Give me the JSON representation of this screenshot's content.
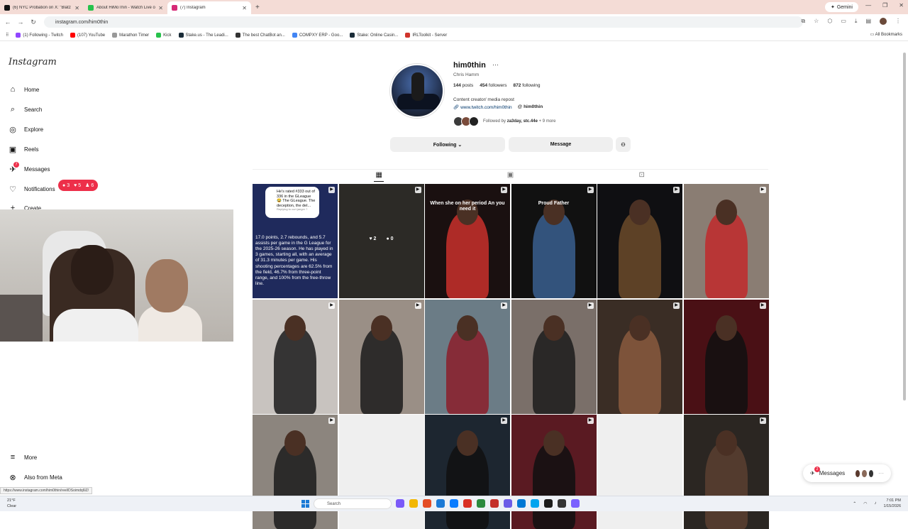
{
  "browser": {
    "tabs": [
      {
        "title": "(6) NYC Probation on X: \"Blatz",
        "color": "#111111"
      },
      {
        "title": "About HiMoThin - Watch Live o",
        "color": "#27c24c"
      },
      {
        "title": "(7) Instagram",
        "color": "#d62976"
      }
    ],
    "gemini_label": "Gemini",
    "url": "instagram.com/him0thin",
    "bookmarks": [
      {
        "label": "(1) Following - Twitch",
        "color": "#9146ff"
      },
      {
        "label": "(107) YouTube",
        "color": "#ff0000"
      },
      {
        "label": "Marathon Timer",
        "color": "#999999"
      },
      {
        "label": "Kick",
        "color": "#27c24c"
      },
      {
        "label": "Stake.us - The Leadi...",
        "color": "#1a2c38"
      },
      {
        "label": "The best ChatBot an...",
        "color": "#333333"
      },
      {
        "label": "COMPXY ERP - Goo...",
        "color": "#4285f4"
      },
      {
        "label": "Stake: Online Casin...",
        "color": "#1a2c38"
      },
      {
        "label": "IRLToolkit - Server",
        "color": "#d0342c"
      }
    ],
    "all_bookmarks": "All Bookmarks",
    "status_url": "https://www.instagram.com/him0thin/reel/DSoimdq6lZ/"
  },
  "sidebar": {
    "logo": "Instagram",
    "items": [
      {
        "label": "Home",
        "icon": "home-icon",
        "glyph": "⌂"
      },
      {
        "label": "Search",
        "icon": "search-icon",
        "glyph": "⌕"
      },
      {
        "label": "Explore",
        "icon": "explore-icon",
        "glyph": "◎"
      },
      {
        "label": "Reels",
        "icon": "reels-icon",
        "glyph": "▣"
      },
      {
        "label": "Messages",
        "icon": "messages-icon",
        "glyph": "✈"
      },
      {
        "label": "Notifications",
        "icon": "heart-icon",
        "glyph": "♡"
      },
      {
        "label": "Create",
        "icon": "plus-icon",
        "glyph": "+"
      }
    ],
    "messages_badge": "7",
    "notif_counts": {
      "comments": "3",
      "likes": "5",
      "follows": "6"
    },
    "more": "More",
    "also_from_meta": "Also from Meta"
  },
  "profile": {
    "username": "him0thin",
    "full_name": "Chris Hamm",
    "posts": "144",
    "posts_label": "posts",
    "followers": "454",
    "followers_label": "followers",
    "following": "872",
    "following_label": "following",
    "bio": "Content creator/ media repost",
    "link": "www.twitch.com/him0thin",
    "threads": "him0thin",
    "followed_by_prefix": "Followed by ",
    "followed_by_names": "za3day, stc.44e",
    "followed_by_more": " + 9 more",
    "following_button": "Following ⌄",
    "message_button": "Message",
    "suggest_icon": "add-person-icon"
  },
  "grid": {
    "posts": [
      {
        "bg": "#1f2a5c",
        "bubble": "He's rated #333 out of 336 in the GLeague 😂 The GLeague. The deception, the del...",
        "bubble_reply": "Replying to curt.jaeger ?",
        "caption": "17.0 points, 2.7 rebounds, and 5.7 assists per game in the G League for the 2025-26 season. He has played in 3 games, starting all, with an average of 31.3 minutes per game. His shooting percentages are 62.5% from the field, 46.7% from three-point range, and 100% from the free-throw line."
      },
      {
        "bg": "#2c2a26",
        "likes": "2",
        "comments": "0"
      },
      {
        "bg": "#1a1010",
        "overlay": "When she on her period An you need it",
        "accent": "#c9302c"
      },
      {
        "bg": "#111111",
        "overlay": "Proud Father",
        "accent": "#3a5f8f"
      },
      {
        "bg": "#0f0f12",
        "accent": "#6b4a2a"
      },
      {
        "bg": "#8a7d73",
        "accent": "#c0292b"
      },
      {
        "bg": "#c8c3bf",
        "accent": "#1b1b1b"
      },
      {
        "bg": "#9a8f86",
        "accent": "#1b1b1b"
      },
      {
        "bg": "#6b7c86",
        "accent": "#8b1e2a"
      },
      {
        "bg": "#7a6f69",
        "accent": "#1c1c1c"
      },
      {
        "bg": "#3a2d25",
        "accent": "#8a5a3e"
      },
      {
        "bg": "#4a1015",
        "accent": "#111111"
      },
      {
        "bg": "#8c857e",
        "accent": "#1b1b1b"
      },
      {
        "bg": "#efefef",
        "accent": "#efefef"
      },
      {
        "bg": "#1d2630",
        "accent": "#111111"
      },
      {
        "bg": "#5a1a22",
        "accent": "#111111"
      },
      {
        "bg": "#efefef",
        "accent": "#efefef"
      },
      {
        "bg": "#2b2622",
        "accent": "#5a4030"
      }
    ]
  },
  "messages_pill": "Messages",
  "messages_pill_badge": "2",
  "taskbar": {
    "temp": "21°F",
    "weather": "Clear",
    "search": "Search",
    "time": "7:01 PM",
    "date": "1/15/2026",
    "app_colors": [
      "#7a5af8",
      "#f2b705",
      "#e44d26",
      "#1b7ad6",
      "#0a7cff",
      "#d93025",
      "#2b8a3e",
      "#c4302b",
      "#6c5ce7",
      "#0078d4",
      "#00a4ef",
      "#1b1b1b",
      "#333333",
      "#7b61ff"
    ]
  }
}
